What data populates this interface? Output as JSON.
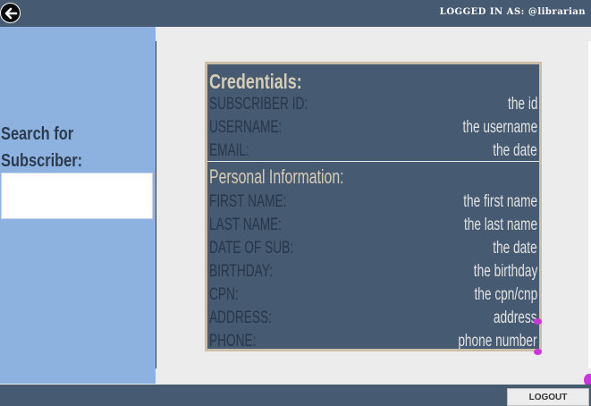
{
  "header": {
    "back_icon": "back-arrow-icon",
    "logged_in_text": "LOGGED IN AS: @librarian"
  },
  "sidebar": {
    "search_label": "Search for Subscriber:",
    "search_value": ""
  },
  "credentials": {
    "title": "Credentials:",
    "fields": [
      {
        "label": "SUBSCRIBER ID:",
        "value": "the id"
      },
      {
        "label": "USERNAME:",
        "value": "the username"
      },
      {
        "label": "EMAIL:",
        "value": "the date"
      }
    ]
  },
  "personal": {
    "title": "Personal Information:",
    "fields": [
      {
        "label": "FIRST NAME:",
        "value": "the first name"
      },
      {
        "label": "LAST NAME:",
        "value": "the last name"
      },
      {
        "label": "DATE OF SUB:",
        "value": "the date"
      },
      {
        "label": "BIRTHDAY:",
        "value": "the birthday"
      },
      {
        "label": "CPN:",
        "value": "the cpn/cnp"
      },
      {
        "label": "ADDRESS:",
        "value": "address"
      },
      {
        "label": "PHONE:",
        "value": "phone number"
      }
    ]
  },
  "footer": {
    "logout_label": "LOGOUT"
  },
  "colors": {
    "bar": "#465a72",
    "sidebar": "#8db2e0",
    "panel": "#465a72",
    "panel_border": "#cdbfa6",
    "handle": "#cc33dd"
  }
}
